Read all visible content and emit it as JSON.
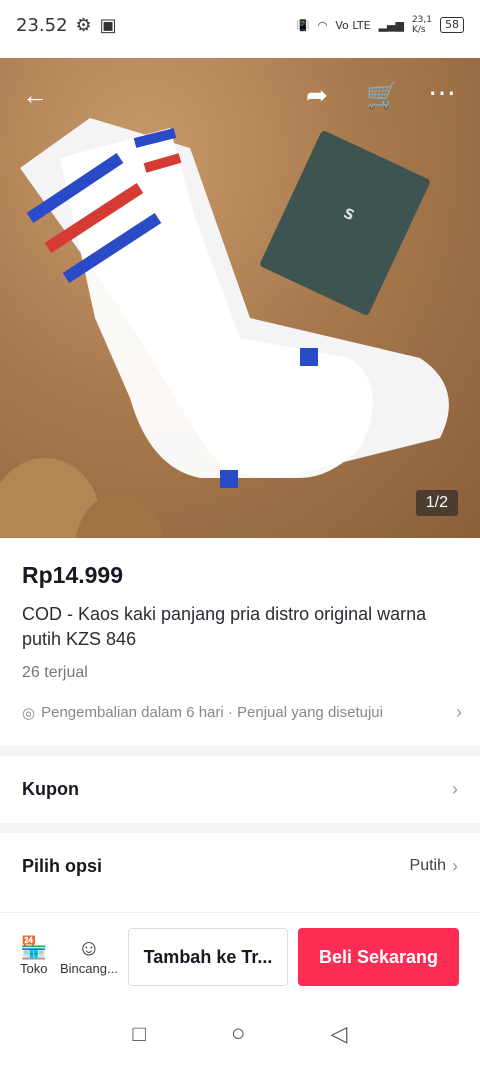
{
  "status": {
    "time": "23.52",
    "net_speed": "23,1",
    "net_unit": "K/s",
    "battery": "58",
    "lte": "Vo LTE"
  },
  "hero": {
    "counter": "1/2"
  },
  "product": {
    "price": "Rp14.999",
    "title": "COD - Kaos kaki panjang pria distro original warna putih KZS 846",
    "sold": "26 terjual",
    "policy": "Pengembalian dalam 6 hari · Penjual yang disetujui"
  },
  "rows": {
    "coupon": "Kupon",
    "options": "Pilih opsi",
    "option_value": "Putih"
  },
  "bottom": {
    "shop": "Toko",
    "chat": "Bincang...",
    "add_cart": "Tambah ke Tr...",
    "buy": "Beli Sekarang"
  },
  "colors": {
    "accent": "#fe2c55"
  }
}
